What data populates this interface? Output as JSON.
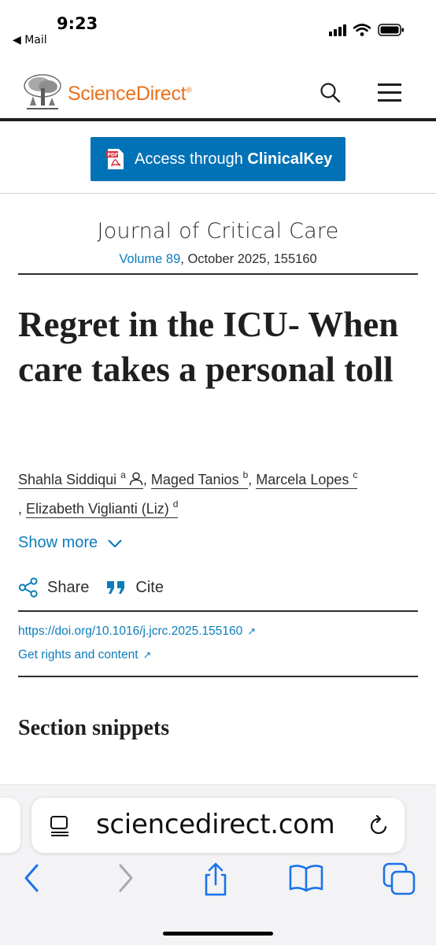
{
  "status_bar": {
    "time": "9:23",
    "back_app": "◀ Mail"
  },
  "header": {
    "brand": "ScienceDirect",
    "brand_mark": "®",
    "brand_color": "#e9711c"
  },
  "access": {
    "prefix": "Access through ",
    "provider": "ClinicalKey",
    "button_color": "#0272b6"
  },
  "journal": {
    "title": "Journal of Critical Care",
    "volume_link": "Volume 89",
    "meta_rest": ", October 2025, 155160"
  },
  "article": {
    "title": "Regret in the ICU- When care takes a personal toll",
    "authors": [
      {
        "name": "Shahla Siddiqui",
        "sup": "a"
      },
      {
        "name": "Maged Tanios",
        "sup": "b"
      },
      {
        "name": "Marcela Lopes",
        "sup": "c"
      },
      {
        "name": "Elizabeth Viglianti (Liz)",
        "sup": "d"
      }
    ],
    "show_more": "Show more",
    "share": "Share",
    "cite": "Cite",
    "doi": "https://doi.org/10.1016/j.jcrc.2025.155160",
    "rights": "Get rights and content",
    "ext_arrow": "↗",
    "section_heading": "Section snippets"
  },
  "browser": {
    "url": "sciencedirect.com"
  },
  "colors": {
    "link": "#0c7dbb",
    "text": "#2e2e2e"
  }
}
